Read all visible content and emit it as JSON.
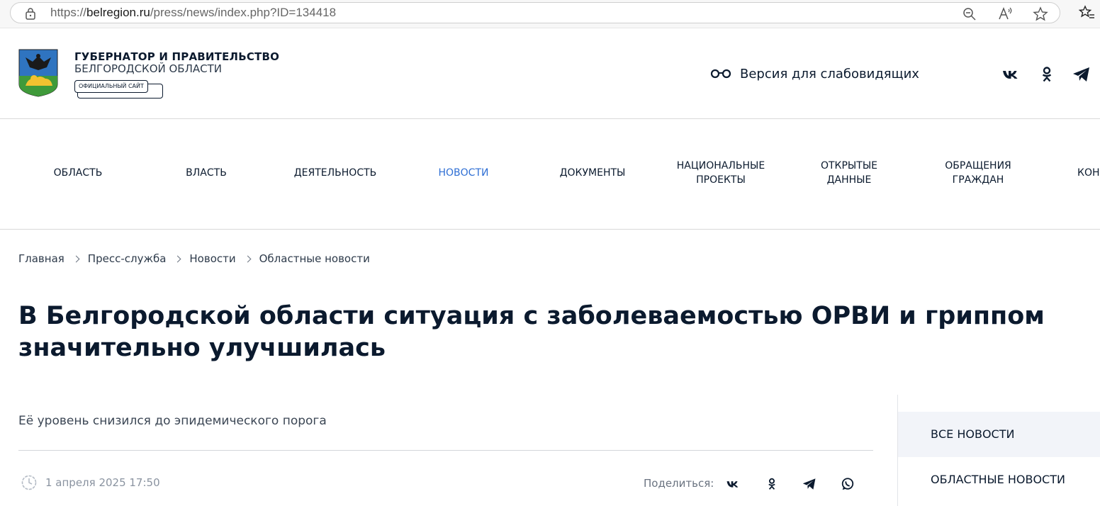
{
  "browser": {
    "url_prefix": "https://",
    "url_domain": "belregion.ru",
    "url_path": "/press/news/index.php?ID=134418"
  },
  "header": {
    "title": "ГУБЕРНАТОР И ПРАВИТЕЛЬСТВО",
    "subtitle": "БЕЛГОРОДСКОЙ ОБЛАСТИ",
    "badge": "ОФИЦИАЛЬНЫЙ САЙТ",
    "vision_label": "Версия для слабовидящих"
  },
  "nav": [
    {
      "label": "ОБЛАСТЬ"
    },
    {
      "label": "ВЛАСТЬ"
    },
    {
      "label": "ДЕЯТЕЛЬНОСТЬ"
    },
    {
      "label": "НОВОСТИ"
    },
    {
      "label": "ДОКУМЕНТЫ"
    },
    {
      "label": "НАЦИОНАЛЬНЫЕ\nПРОЕКТЫ"
    },
    {
      "label": "ОТКРЫТЫЕ\nДАННЫЕ"
    },
    {
      "label": "ОБРАЩЕНИЯ\nГРАЖДАН"
    },
    {
      "label": "КОН"
    }
  ],
  "breadcrumbs": [
    "Главная",
    "Пресс-служба",
    "Новости",
    "Областные новости"
  ],
  "article": {
    "title": "В Белгородской области ситуация с заболеваемостью ОРВИ и гриппом значительно улучшилась",
    "lead": "Её уровень снизился до эпидемического порога",
    "date": "1 апреля 2025 17:50",
    "share_label": "Поделиться:"
  },
  "sidebar": {
    "items": [
      "ВСЕ НОВОСТИ",
      "ОБЛАСТНЫЕ НОВОСТИ"
    ]
  },
  "colors": {
    "accent": "#2f6fd4",
    "text": "#0b1a2e",
    "muted": "#8a93a0"
  }
}
